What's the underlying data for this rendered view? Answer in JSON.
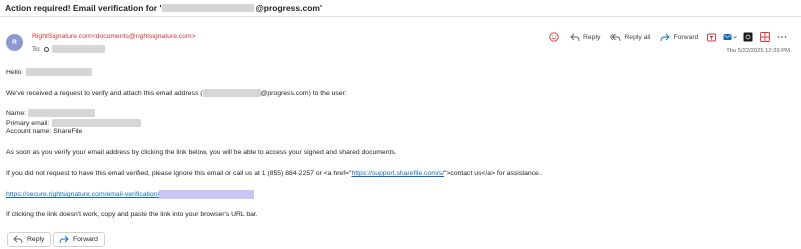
{
  "subject": {
    "prefix": "Action required! Email verification for '",
    "suffix": "@progress.com'"
  },
  "header": {
    "avatar_initial": "R",
    "sender": "RightSignature.com<documents@rightsignature.com>",
    "to_label": "To:",
    "date": "Thu 5/22/2025 12:39 PM",
    "actions": {
      "reply": "Reply",
      "reply_all": "Reply all",
      "forward": "Forward"
    }
  },
  "body": {
    "greeting": "Hello",
    "intro_prefix": "We've received a request to verify and attach this email address (",
    "intro_suffix": "@progress.com) to the user:",
    "name_label": "Name:",
    "primary_email_label": "Primary email:",
    "account_name": "Account name: ShareFile",
    "verify_text": "As soon as you verify your email address by clicking the link below, you will be able to access your signed and shared documents.",
    "ignore_prefix": "If you did not request to have this email verified, please ignore this email or call us at 1 (855) 884-2257 or <a href=\"",
    "support_link": "https://support.sharefile.com/s/",
    "ignore_suffix": "\">contact us</a> for assistance..",
    "verify_link": "https://secure.rightsignature.com/email-verification/",
    "copy_hint": "If clicking the link doesn't work, copy and paste the link into your browser's URL bar."
  },
  "footer": {
    "reply": "Reply",
    "forward": "Forward"
  },
  "colors": {
    "sender": "#d13438",
    "link": "#0f6cbd",
    "avatar": "#8c9ad1",
    "link_highlight": "#c9c6f5"
  }
}
